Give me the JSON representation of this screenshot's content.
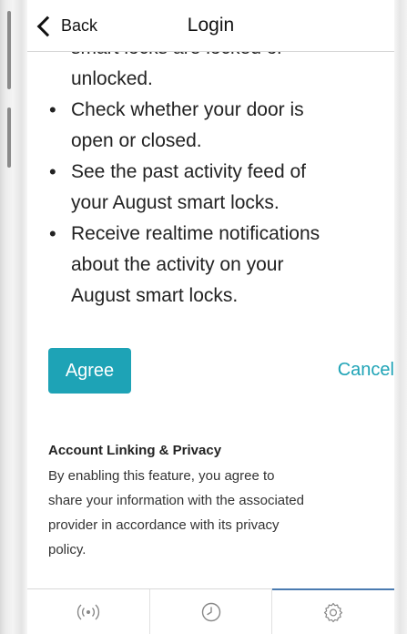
{
  "navbar": {
    "back_label": "Back",
    "title": "Login"
  },
  "permissions": {
    "top_cutoff": "smart locks are locked or",
    "item1_cont": "unlocked.",
    "items": [
      {
        "lines": [
          "Check whether your door is",
          "open or closed."
        ]
      },
      {
        "lines": [
          "See the past activity feed of",
          "your August smart locks."
        ]
      },
      {
        "lines": [
          "Receive realtime notifications",
          "about the activity on your",
          "August smart locks."
        ]
      }
    ]
  },
  "actions": {
    "agree_label": "Agree",
    "cancel_label": "Cancel"
  },
  "privacy": {
    "title": "Account Linking & Privacy",
    "lines": [
      "By enabling this feature, you agree to",
      "share your information with the associated",
      "provider in accordance with its privacy",
      "policy."
    ]
  },
  "tabbar": {
    "tabs": [
      {
        "icon": "broadcast-icon",
        "active": false
      },
      {
        "icon": "history-icon",
        "active": false
      },
      {
        "icon": "gear-icon",
        "active": true
      }
    ]
  },
  "colors": {
    "accent": "#1ea3b6",
    "tab_active_indicator": "#4a7bb0"
  }
}
